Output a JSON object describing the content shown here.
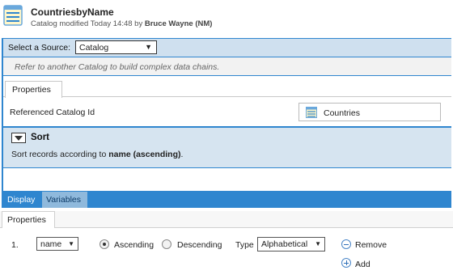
{
  "header": {
    "title": "CountriesbyName",
    "subtitle_prefix": "Catalog modified Today 14:48 by ",
    "author": "Bruce Wayne (NM)",
    "icon": "catalog-table-icon"
  },
  "source": {
    "label": "Select a Source:",
    "selected": "Catalog",
    "hint": "Refer to another Catalog to build complex data chains."
  },
  "properties_tab": "Properties",
  "referenced_catalog": {
    "label": "Referenced Catalog Id",
    "value": "Countries",
    "icon": "catalog-table-icon"
  },
  "sort": {
    "title": "Sort",
    "desc_prefix": "Sort records according to ",
    "desc_field": "name (ascending)",
    "desc_suffix": "."
  },
  "bottom_tabs": {
    "display": "Display",
    "variables": "Variables"
  },
  "lower": {
    "tab": "Properties",
    "row_number": "1.",
    "field": "name",
    "ascending_label": "Ascending",
    "descending_label": "Descending",
    "ascending_selected": true,
    "type_label": "Type",
    "type_value": "Alphabetical",
    "remove_label": "Remove",
    "add_label": "Add"
  },
  "colors": {
    "accent": "#2f86cf",
    "panel": "#d6e4f0"
  }
}
